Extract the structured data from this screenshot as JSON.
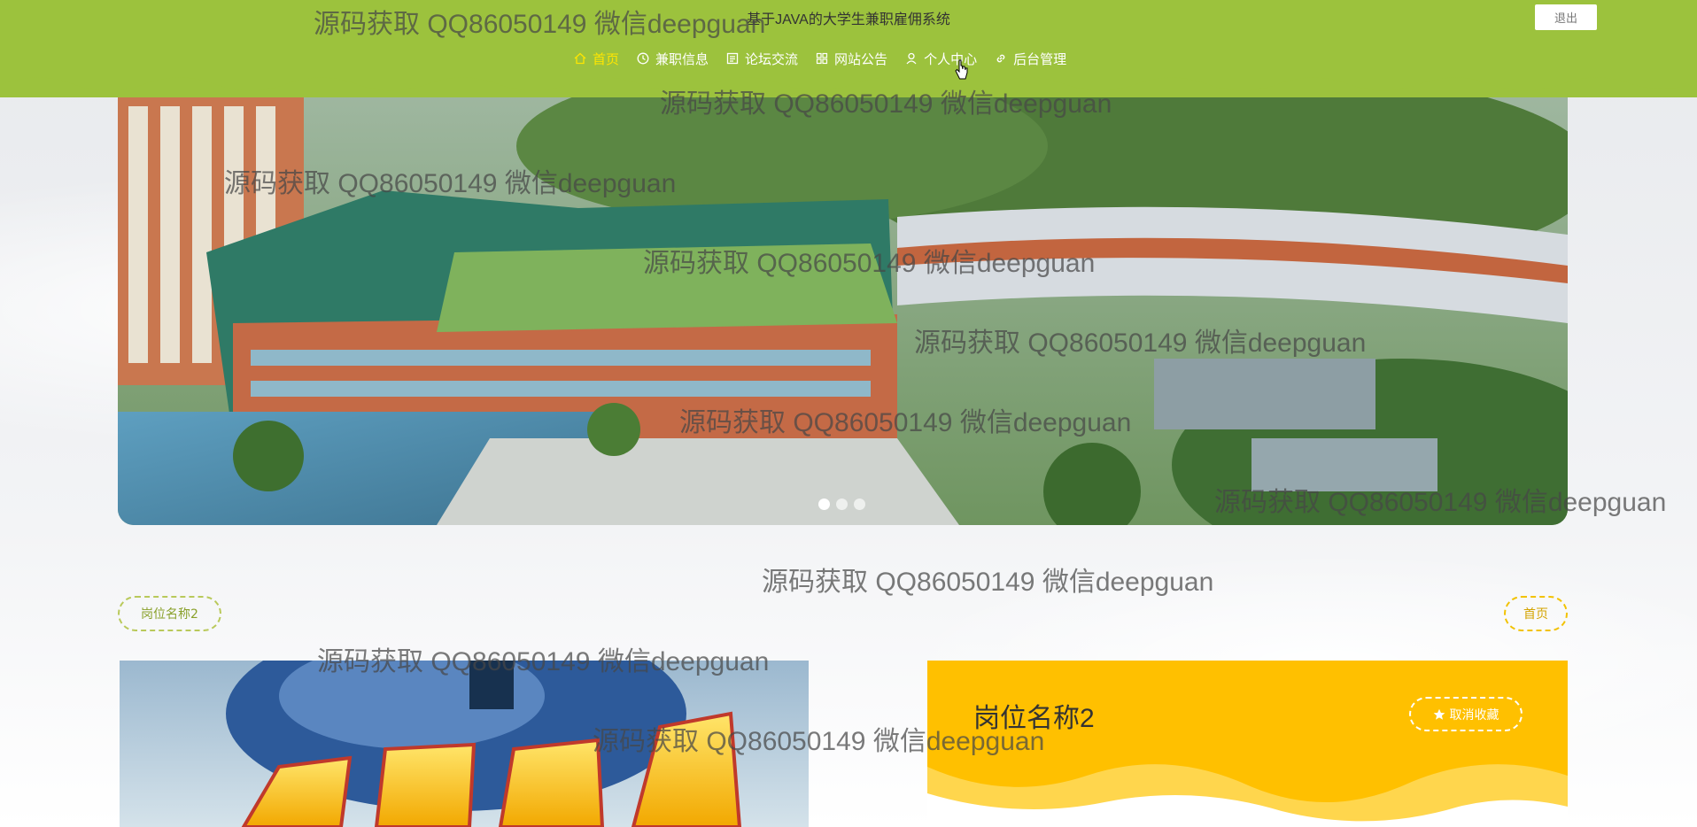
{
  "header": {
    "site_title": "基于JAVA的大学生兼职雇佣系统",
    "logout_label": "退出",
    "nav": [
      {
        "label": "首页",
        "icon": "home-icon",
        "active": true
      },
      {
        "label": "兼职信息",
        "icon": "clock-icon"
      },
      {
        "label": "论坛交流",
        "icon": "document-icon"
      },
      {
        "label": "网站公告",
        "icon": "grid-icon"
      },
      {
        "label": "个人中心",
        "icon": "user-icon"
      },
      {
        "label": "后台管理",
        "icon": "link-icon"
      }
    ]
  },
  "carousel": {
    "slide_count": 3,
    "active_index": 0
  },
  "breadcrumb": {
    "current": "岗位名称2",
    "home_label": "首页"
  },
  "job": {
    "title": "岗位名称2",
    "favorite_label": "取消收藏"
  },
  "watermark_text": "源码获取 QQ86050149 微信deepguan",
  "colors": {
    "header_green": "#9cc23d",
    "nav_active": "#ffe600",
    "card_yellow": "#ffc000"
  }
}
